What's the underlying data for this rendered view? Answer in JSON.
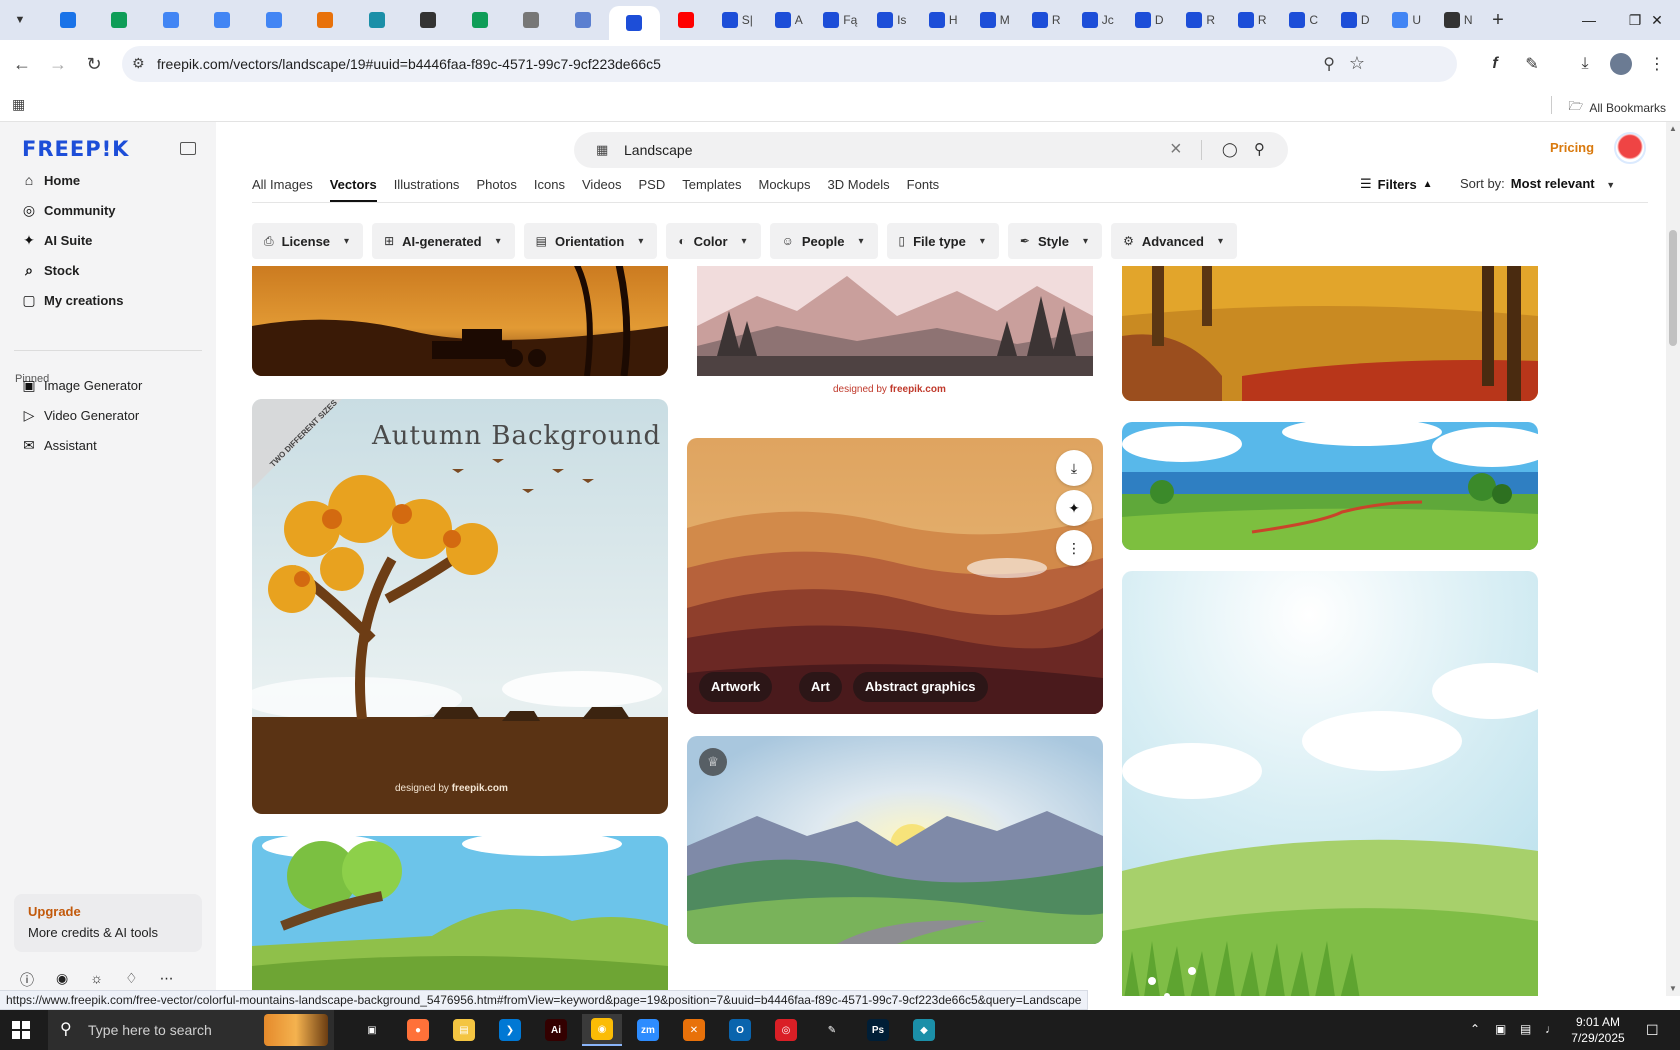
{
  "browser": {
    "tabs": [
      {
        "icon": "vpn-icon",
        "title": "",
        "color": "#1a73e8"
      },
      {
        "icon": "sheets-icon",
        "title": "",
        "color": "#0f9d58"
      },
      {
        "icon": "docs-icon",
        "title": "",
        "color": "#4285f4"
      },
      {
        "icon": "docs-icon",
        "title": "",
        "color": "#4285f4"
      },
      {
        "icon": "docs-icon",
        "title": "",
        "color": "#4285f4"
      },
      {
        "icon": "app-icon",
        "title": "",
        "color": "#e8710a"
      },
      {
        "icon": "app-icon",
        "title": "",
        "color": "#1b8fa8"
      },
      {
        "icon": "chatgpt-icon",
        "title": "",
        "color": "#333333"
      },
      {
        "icon": "sheets-icon",
        "title": "",
        "color": "#0f9d58"
      },
      {
        "icon": "globe-icon",
        "title": "",
        "color": "#777777"
      },
      {
        "icon": "app-icon",
        "title": "",
        "color": "#5b7fd0"
      },
      {
        "icon": "freepik-icon",
        "title": "",
        "color": "#1d4ed8",
        "active": true
      },
      {
        "icon": "youtube-icon",
        "title": "",
        "color": "#ff0000"
      },
      {
        "icon": "freepik-icon",
        "title": "S|",
        "color": "#1d4ed8"
      },
      {
        "icon": "freepik-icon",
        "title": "A",
        "color": "#1d4ed8"
      },
      {
        "icon": "freepik-icon",
        "title": "Fą",
        "color": "#1d4ed8"
      },
      {
        "icon": "freepik-icon",
        "title": "Is",
        "color": "#1d4ed8"
      },
      {
        "icon": "freepik-icon",
        "title": "H",
        "color": "#1d4ed8"
      },
      {
        "icon": "freepik-icon",
        "title": "M",
        "color": "#1d4ed8"
      },
      {
        "icon": "freepik-icon",
        "title": "R",
        "color": "#1d4ed8"
      },
      {
        "icon": "freepik-icon",
        "title": "Jc",
        "color": "#1d4ed8"
      },
      {
        "icon": "freepik-icon",
        "title": "D",
        "color": "#1d4ed8"
      },
      {
        "icon": "freepik-icon",
        "title": "R",
        "color": "#1d4ed8"
      },
      {
        "icon": "freepik-icon",
        "title": "R",
        "color": "#1d4ed8"
      },
      {
        "icon": "freepik-icon",
        "title": "C",
        "color": "#1d4ed8"
      },
      {
        "icon": "freepik-icon",
        "title": "D",
        "color": "#1d4ed8"
      },
      {
        "icon": "google-icon",
        "title": "U",
        "color": "#4285f4"
      },
      {
        "icon": "chatgpt-icon",
        "title": "N",
        "color": "#333333"
      }
    ],
    "url": "freepik.com/vectors/landscape/19#uuid=b4446faa-f89c-4571-99c7-9cf223de66c5",
    "bookmarks_all": "All Bookmarks",
    "status_url": "https://www.freepik.com/free-vector/colorful-mountains-landscape-background_5476956.htm#fromView=keyword&page=19&position=7&uuid=b4446faa-f89c-4571-99c7-9cf223de66c5&query=Landscape"
  },
  "sidebar": {
    "logo": "FREEP!K",
    "nav": [
      {
        "label": "Home",
        "icon": "home-icon",
        "glyph": "⌂"
      },
      {
        "label": "Community",
        "icon": "globe-icon",
        "glyph": "◎"
      },
      {
        "label": "AI Suite",
        "icon": "sparkle-icon",
        "glyph": "✦"
      },
      {
        "label": "Stock",
        "icon": "search-icon",
        "glyph": "⌕"
      },
      {
        "label": "My creations",
        "icon": "folder-icon",
        "glyph": "▢"
      }
    ],
    "pinned_label": "Pinned",
    "pinned": [
      {
        "label": "Image Generator",
        "icon": "image-icon",
        "glyph": "▣"
      },
      {
        "label": "Video Generator",
        "icon": "video-icon",
        "glyph": "▷"
      },
      {
        "label": "Assistant",
        "icon": "chat-icon",
        "glyph": "✉"
      }
    ],
    "upgrade_title": "Upgrade",
    "upgrade_sub": "More credits & AI tools"
  },
  "header": {
    "search_value": "Landscape",
    "pricing": "Pricing"
  },
  "type_tabs": [
    "All Images",
    "Vectors",
    "Illustrations",
    "Photos",
    "Icons",
    "Videos",
    "PSD",
    "Templates",
    "Mockups",
    "3D Models",
    "Fonts"
  ],
  "active_type_tab": "Vectors",
  "filters_label": "Filters",
  "sort": {
    "label": "Sort by:",
    "value": "Most relevant"
  },
  "chips": [
    {
      "label": "License",
      "icon": "license-icon",
      "glyph": "⎙"
    },
    {
      "label": "AI-generated",
      "icon": "ai-icon",
      "glyph": "⊞"
    },
    {
      "label": "Orientation",
      "icon": "orientation-icon",
      "glyph": "▤"
    },
    {
      "label": "Color",
      "icon": "palette-icon",
      "glyph": "◐"
    },
    {
      "label": "People",
      "icon": "people-icon",
      "glyph": "☺"
    },
    {
      "label": "File type",
      "icon": "file-icon",
      "glyph": "▯"
    },
    {
      "label": "Style",
      "icon": "brush-icon",
      "glyph": "✒"
    },
    {
      "label": "Advanced",
      "icon": "gear-icon",
      "glyph": "⚙"
    }
  ],
  "cards": {
    "autumn_title": "Autumn Background",
    "autumn_ribbon": "TWO DIFFERENT SIZES",
    "designed_by": "designed by",
    "freepik": "freepik.com",
    "tags": [
      "Artwork",
      "Art",
      "Abstract graphics"
    ]
  },
  "taskbar": {
    "search_placeholder": "Type here to search",
    "time": "9:01 AM",
    "date": "7/29/2025"
  }
}
